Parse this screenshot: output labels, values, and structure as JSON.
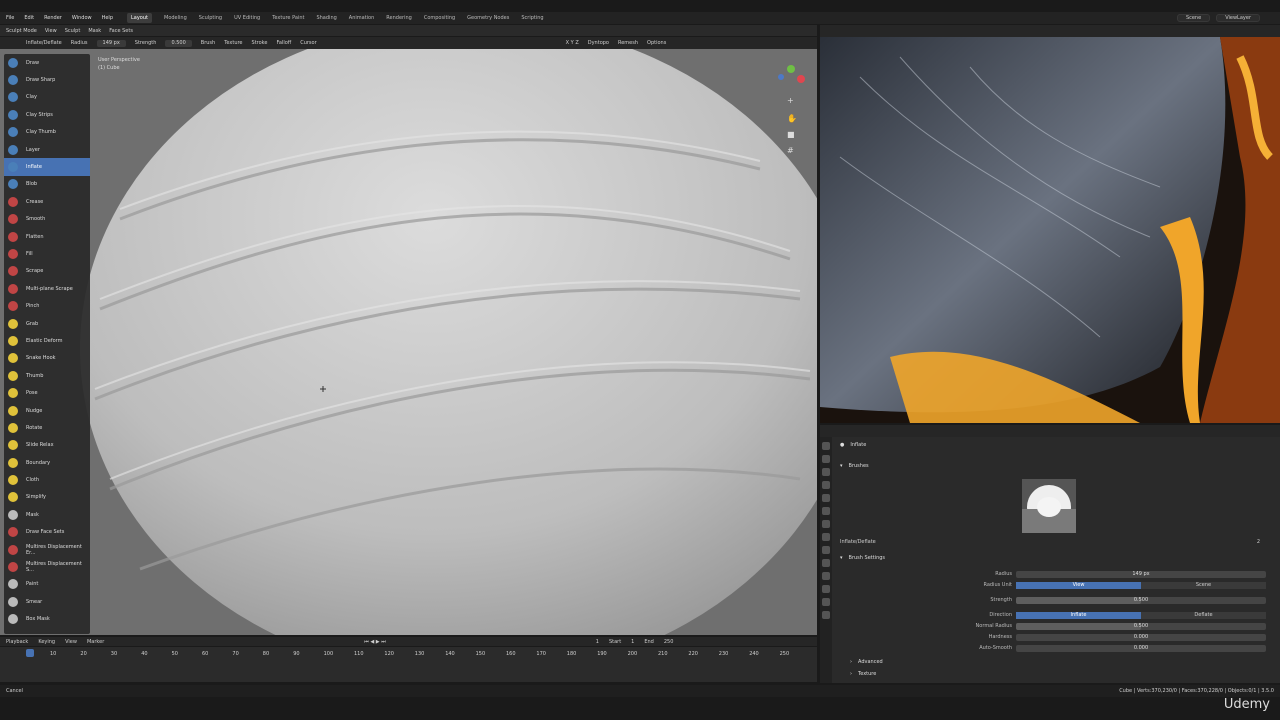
{
  "menus": [
    "File",
    "Edit",
    "Render",
    "Window",
    "Help"
  ],
  "workspaces": [
    "Layout",
    "Modeling",
    "Sculpting",
    "UV Editing",
    "Texture Paint",
    "Shading",
    "Animation",
    "Rendering",
    "Compositing",
    "Geometry Nodes",
    "Scripting"
  ],
  "active_workspace": "Layout",
  "scene": "Scene",
  "view_layer": "ViewLayer",
  "viewport_header": {
    "mode": "Sculpt Mode",
    "items": [
      "View",
      "Sculpt",
      "Mask",
      "Face Sets"
    ]
  },
  "tool_settings": {
    "brush": "Inflate/Deflate",
    "radius_label": "Radius",
    "radius": "149 px",
    "strength_label": "Strength",
    "strength": "0.500",
    "menus": [
      "Brush",
      "Texture",
      "Stroke",
      "Falloff",
      "Cursor"
    ],
    "right": [
      "Dyntopo",
      "Remesh",
      "Options"
    ],
    "xyz": "X Y Z"
  },
  "vp_info": {
    "view": "User Perspective",
    "object": "(1) Cube"
  },
  "tools": [
    "Draw",
    "Draw Sharp",
    "Clay",
    "Clay Strips",
    "Clay Thumb",
    "Layer",
    "Inflate",
    "Blob",
    "Crease",
    "Smooth",
    "Flatten",
    "Fill",
    "Scrape",
    "Multi-plane Scrape",
    "Pinch",
    "Grab",
    "Elastic Deform",
    "Snake Hook",
    "Thumb",
    "Pose",
    "Nudge",
    "Rotate",
    "Slide Relax",
    "Boundary",
    "Cloth",
    "Simplify",
    "Mask",
    "Draw Face Sets",
    "Multires Displacement Er...",
    "Multires Displacement S...",
    "Paint",
    "Smear",
    "Box Mask"
  ],
  "active_tool": "Inflate",
  "timeline": {
    "items": [
      "Playback",
      "Keying",
      "View",
      "Marker"
    ],
    "current": "1",
    "start_label": "Start",
    "start": "1",
    "end_label": "End",
    "end": "250",
    "ticks": [
      "10",
      "20",
      "30",
      "40",
      "50",
      "60",
      "70",
      "80",
      "90",
      "100",
      "110",
      "120",
      "130",
      "140",
      "150",
      "160",
      "170",
      "180",
      "190",
      "200",
      "210",
      "220",
      "230",
      "240",
      "250"
    ]
  },
  "properties": {
    "object": "Inflate",
    "brushes_label": "Brushes",
    "brush_name": "Inflate/Deflate",
    "brush_users": "2",
    "settings_label": "Brush Settings",
    "radius_label": "Radius",
    "radius": "149 px",
    "radius_unit_label": "Radius Unit",
    "radius_unit": [
      "View",
      "Scene"
    ],
    "strength_label": "Strength",
    "strength": "0.500",
    "direction_label": "Direction",
    "direction": [
      "Inflate",
      "Deflate"
    ],
    "normal_radius_label": "Normal Radius",
    "normal_radius": "0.500",
    "hardness_label": "Hardness",
    "hardness": "0.000",
    "autosmooth_label": "Auto-Smooth",
    "autosmooth": "0.000",
    "advanced": "Advanced",
    "texture": "Texture"
  },
  "status": {
    "left": "Cancel",
    "right": "Cube | Verts:370,230/0 | Faces:370,228/0 | Objects:0/1 | 3.5.0"
  },
  "watermark": "Udemy"
}
